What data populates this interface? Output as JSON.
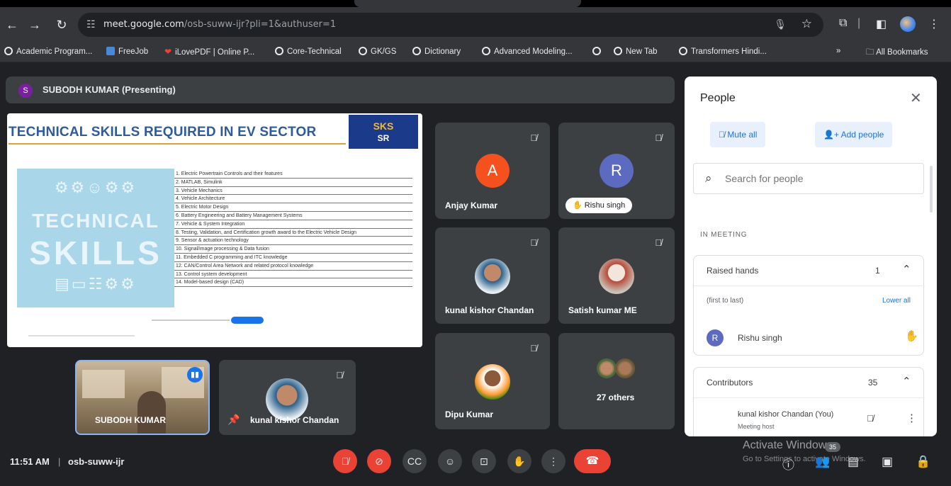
{
  "browser": {
    "url_host": "meet.google.com",
    "url_path": "/osb-suww-ijr?pli=1&authuser=1",
    "bookmarks": [
      {
        "label": "Academic Program...",
        "icon": "globe-icon"
      },
      {
        "label": "FreeJob",
        "icon": "freejob-icon"
      },
      {
        "label": "iLovePDF | Online P...",
        "icon": "heart-icon"
      },
      {
        "label": "Core-Technical",
        "icon": "globe-icon"
      },
      {
        "label": "GK/GS",
        "icon": "globe-icon"
      },
      {
        "label": "Dictionary",
        "icon": "globe-icon"
      },
      {
        "label": "Advanced Modeling...",
        "icon": "globe-icon"
      },
      {
        "label": "",
        "icon": "globe-icon"
      },
      {
        "label": "New Tab",
        "icon": "globe-icon"
      },
      {
        "label": "Transformers Hindi...",
        "icon": "globe-icon"
      }
    ],
    "more": "»",
    "all_bookmarks": "All Bookmarks"
  },
  "presenter": {
    "initial": "S",
    "label": "SUBODH KUMAR (Presenting)"
  },
  "slide": {
    "title": "TECHNICAL SKILLS REQUIRED IN EV SECTOR",
    "logo_top": "SKS",
    "logo_bottom": "SR",
    "picture_word1": "TECHNICAL",
    "picture_word2": "SKILLS",
    "items": [
      "1. Electric Powertrain Controls and their features",
      "2. MATLAB, Simulink",
      "3. Vehicle Mechanics",
      "4. Vehicle Architecture",
      "5. Electric Motor Design",
      "6. Battery Engineering and Battery Management Systems",
      "7. Vehicle & System Integration",
      "8. Testing, Validation, and Certification growth award to the Electric Vehicle Design",
      "9. Sensor & actuation technology",
      "10. Signal/image processing & Data fusion",
      "11. Embedded C programming and ITC knowledge",
      "12. CAN/Control Area Network and related protocol knowledge",
      "13. Control system development",
      "14. Model-based design (CAD)"
    ]
  },
  "participants": [
    {
      "name": "Anjay Kumar",
      "initial": "A",
      "color": "#f4511e"
    },
    {
      "name": "Rishu singh",
      "initial": "R",
      "color": "#5c6bc0"
    },
    {
      "name": "kunal kishor Chandan"
    },
    {
      "name": "Satish kumar ME"
    },
    {
      "name": "Dipu Kumar"
    },
    {
      "name": "27 others"
    }
  ],
  "self_tile": {
    "name": "SUBODH KUMAR"
  },
  "pinned_tile": {
    "name": "kunal kishor Chandan"
  },
  "people_panel": {
    "title": "People",
    "mute_all": "Mute all",
    "add_people": "Add people",
    "search_placeholder": "Search for people",
    "section": "IN MEETING",
    "raised_hands": {
      "label": "Raised hands",
      "count": "1",
      "order": "(first to last)",
      "lower_all": "Lower all",
      "person": {
        "initial": "R",
        "name": "Rishu singh"
      }
    },
    "contributors": {
      "label": "Contributors",
      "count": "35",
      "person": {
        "name": "kunal kishor Chandan (You)",
        "role": "Meeting host"
      }
    }
  },
  "bottom_bar": {
    "time": "11:51 AM",
    "separator": "|",
    "meeting_code": "osb-suww-ijr",
    "participant_badge": "35",
    "watermark_line1": "Activate Windows",
    "watermark_line2": "Go to Settings to activate Windows."
  }
}
